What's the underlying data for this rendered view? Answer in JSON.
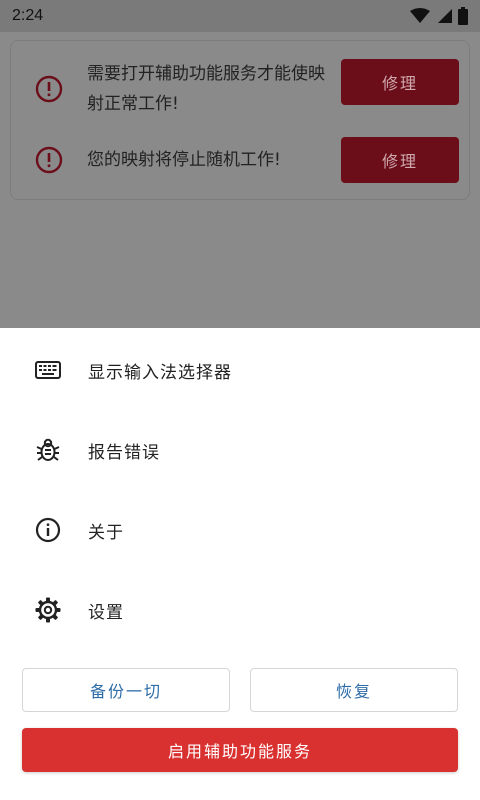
{
  "status_bar": {
    "time": "2:24",
    "icons": [
      "wifi-icon",
      "signal-icon",
      "battery-icon"
    ]
  },
  "warnings": [
    {
      "icon": "alert-circle-icon",
      "text": "需要打开辅助功能服务才能使映射正常工作!",
      "button": "修理"
    },
    {
      "icon": "alert-circle-icon",
      "text": "您的映射将停止随机工作!",
      "button": "修理"
    }
  ],
  "menu": {
    "items": [
      {
        "icon": "keyboard-icon",
        "label": "显示输入法选择器"
      },
      {
        "icon": "bug-icon",
        "label": "报告错误"
      },
      {
        "icon": "info-icon",
        "label": "关于"
      },
      {
        "icon": "gear-icon",
        "label": "设置"
      }
    ]
  },
  "buttons": {
    "backup": "备份一切",
    "restore": "恢复",
    "enable_accessibility": "启用辅助功能服务"
  },
  "colors": {
    "fix_button": "#6b0e1a",
    "primary_button": "#d93030",
    "outline_text": "#2d6ca8"
  }
}
